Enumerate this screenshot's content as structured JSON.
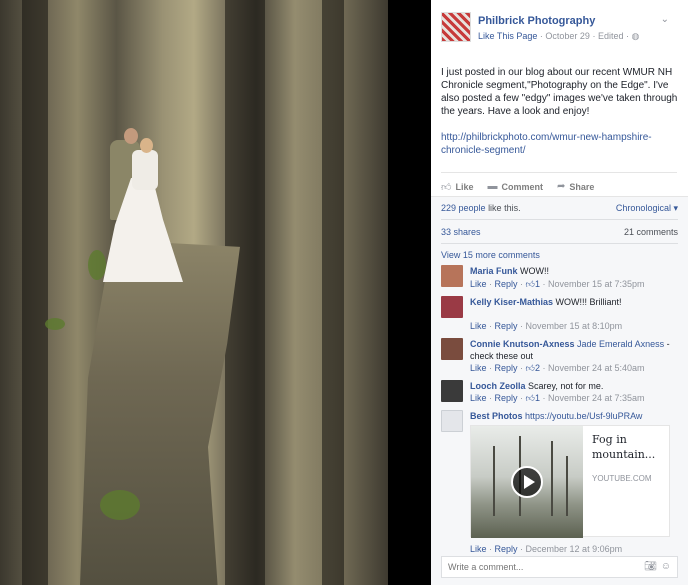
{
  "post": {
    "page_name": "Philbrick Photography",
    "like_link": "Like This Page",
    "date": "October 29",
    "edited": "Edited",
    "text": "I just posted in our blog about our recent WMUR NH Chronicle segment,\"Photography on the Edge\". I've also posted a few \"edgy\" images we've taken through the years. Have a look and enjoy!",
    "link": "http://philbrickphoto.com/wmur-new-hampshire-chronicle-segment/"
  },
  "actions": {
    "like": "Like",
    "comment": "Comment",
    "share": "Share"
  },
  "feedback": {
    "likes_count": "229 people",
    "likes_suffix": "like this.",
    "sort": "Chronological",
    "shares": "33 shares",
    "comments_count": "21 comments",
    "view_more": "View 15 more comments"
  },
  "comments": [
    {
      "name": "Maria Funk",
      "text": "WOW!!",
      "like": "Like",
      "reply": "Reply",
      "reactions": "1",
      "time": "November 15 at 7:35pm",
      "avatar_color": "#b7745a"
    },
    {
      "name": "Kelly Kiser-Mathias",
      "text": "WOW!!! Brilliant!",
      "like": "Like",
      "reply": "Reply",
      "time": "November 15 at 8:10pm",
      "avatar_color": "#9a3a45"
    },
    {
      "name": "Connie Knutson-Axness",
      "mention": "Jade Emerald Axness",
      "text": "- check these out",
      "like": "Like",
      "reply": "Reply",
      "reactions": "2",
      "time": "November 24 at 5:40am",
      "avatar_color": "#7a4c3e"
    },
    {
      "name": "Looch Zeolla",
      "text": "Scarey, not for me.",
      "like": "Like",
      "reply": "Reply",
      "reactions": "1",
      "time": "November 24 at 7:35am",
      "avatar_color": "#3a3a3a"
    },
    {
      "name": "Best Photos",
      "link": "https://youtu.be/Usf-9luPRAw",
      "like": "Like",
      "reply": "Reply",
      "time": "December 12 at 9:06pm",
      "avatar_color": "#e4e6ea"
    }
  ],
  "video": {
    "title": "Fog in mountain...",
    "domain": "YOUTUBE.COM"
  },
  "composer": {
    "placeholder": "Write a comment..."
  }
}
